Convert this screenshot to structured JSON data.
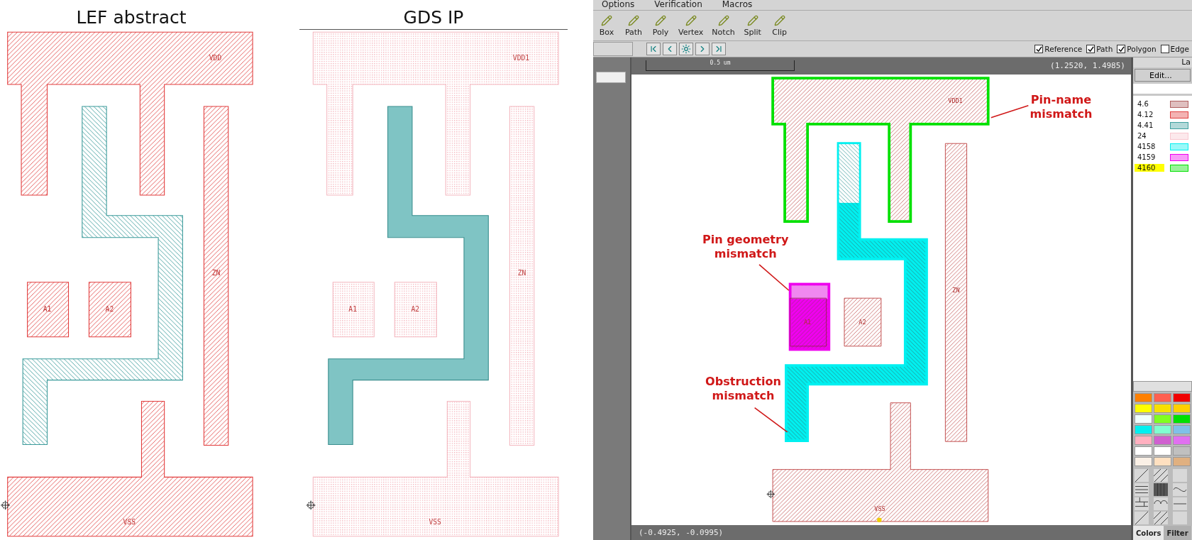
{
  "panels": [
    {
      "kind": "lef",
      "title": "LEF abstract",
      "shapes": [
        {
          "kind": "pin",
          "label": "VDD"
        },
        {
          "kind": "obstruction"
        },
        {
          "kind": "pin",
          "label": "ZN"
        },
        {
          "kind": "pin",
          "label": "A1"
        },
        {
          "kind": "pin",
          "label": "A2"
        },
        {
          "kind": "pin",
          "label": "VSS"
        }
      ]
    },
    {
      "kind": "gds",
      "title": "GDS IP",
      "shapes": [
        {
          "kind": "pin",
          "label": "VDD1"
        },
        {
          "kind": "obstruction"
        },
        {
          "kind": "pin",
          "label": "ZN"
        },
        {
          "kind": "pin",
          "label": "A1"
        },
        {
          "kind": "pin",
          "label": "A2"
        },
        {
          "kind": "pin",
          "label": "VSS"
        }
      ]
    }
  ],
  "editor": {
    "menu": [
      "Options",
      "Verification",
      "Macros"
    ],
    "tools": [
      "Box",
      "Path",
      "Poly",
      "Vertex",
      "Notch",
      "Split",
      "Clip"
    ],
    "filters": [
      {
        "label": "Reference",
        "checked": true
      },
      {
        "label": "Path",
        "checked": true
      },
      {
        "label": "Polygon",
        "checked": true
      },
      {
        "label": "Edge",
        "checked": false
      }
    ],
    "scale": "0.5 um",
    "cursor": "(1.2520, 1.4985)",
    "shapes": [
      {
        "kind": "pin",
        "label": "VDD1",
        "color": "#00e000"
      },
      {
        "kind": "obstruction",
        "color": "#00f0f0"
      },
      {
        "kind": "pin",
        "label": "ZN"
      },
      {
        "kind": "pin",
        "label": "A1",
        "color": "#ee00ee"
      },
      {
        "kind": "pin",
        "label": "A2"
      },
      {
        "kind": "pin",
        "label": "VSS"
      }
    ],
    "callouts": [
      {
        "text": "Pin-name mismatch",
        "kind": "pin_name"
      },
      {
        "text": "Pin geometry mismatch",
        "kind": "pin_geometry"
      },
      {
        "text": "Obstruction mismatch",
        "kind": "obstruction"
      }
    ],
    "panel_title": "La",
    "edit_button": "Edit...",
    "layers": [
      {
        "name": "4.6",
        "color": "#b06060",
        "selected": false
      },
      {
        "name": "4.12",
        "color": "#e04040",
        "selected": false
      },
      {
        "name": "4.41",
        "color": "#40a0a0",
        "selected": false
      },
      {
        "name": "24",
        "color": "#f8c8d0",
        "selected": false
      },
      {
        "name": "4158",
        "color": "#00f0f0",
        "selected": false
      },
      {
        "name": "4159",
        "color": "#f000f0",
        "selected": false
      },
      {
        "name": "4160",
        "color": "#00e000",
        "selected": true
      }
    ],
    "palette": [
      {
        "color": "#ff8000"
      },
      {
        "color": "#ff6050"
      },
      {
        "color": "#f00000"
      },
      {
        "color": "#ffff00"
      },
      {
        "color": "#f8e000"
      },
      {
        "color": "#ffd000"
      },
      {
        "color": "#f0ffff"
      },
      {
        "color": "#80ff20"
      },
      {
        "color": "#00e000"
      },
      {
        "color": "#00f0f0"
      },
      {
        "color": "#80ffd0"
      },
      {
        "color": "#80c0e8"
      },
      {
        "color": "#ffb0c0"
      },
      {
        "color": "#d060d0"
      },
      {
        "color": "#e070f0"
      },
      {
        "color": "#ffffff"
      },
      {
        "color": "#ffffff"
      },
      {
        "color": "#c0c0c0"
      },
      {
        "color": "#faf0e6"
      },
      {
        "color": "#ffe0c0"
      },
      {
        "color": "#e0b080"
      }
    ],
    "tabs": [
      {
        "label": "Colors",
        "selected": true
      },
      {
        "label": "Filter",
        "selected": false
      }
    ],
    "status": "(-0.4925, -0.0995)"
  }
}
